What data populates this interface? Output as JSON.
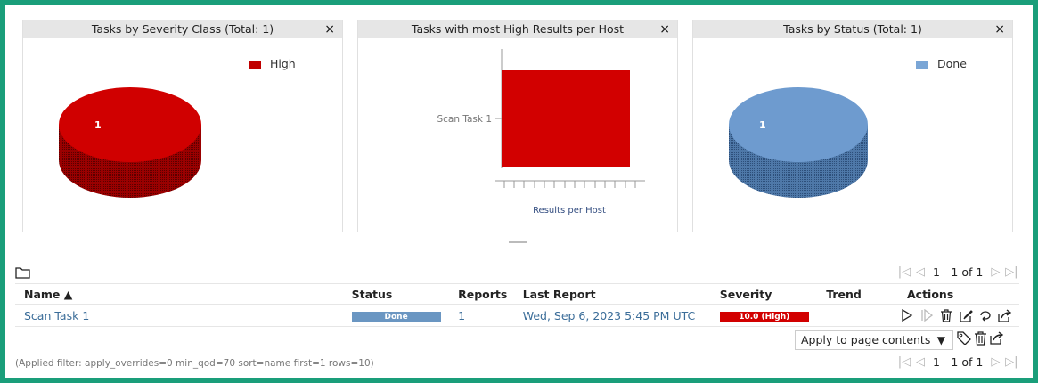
{
  "dashboard": {
    "severity_panel": {
      "title": "Tasks by Severity Class (Total: 1)",
      "legend": "High",
      "slice_label": "1",
      "color": "#d20000"
    },
    "hosts_panel": {
      "title": "Tasks with most High Results per Host",
      "category_label": "Scan Task 1",
      "xlabel": "Results per Host",
      "color": "#d20000"
    },
    "status_panel": {
      "title": "Tasks by Status (Total: 1)",
      "legend": "Done",
      "slice_label": "1",
      "color": "#6a96c2"
    },
    "close_symbol": "×"
  },
  "pager_top": {
    "text": "1 - 1 of 1"
  },
  "pager_bottom": {
    "text": "1 - 1 of 1"
  },
  "table": {
    "headers": {
      "name": "Name ▲",
      "status": "Status",
      "reports": "Reports",
      "last_report": "Last Report",
      "severity": "Severity",
      "trend": "Trend",
      "actions": "Actions"
    },
    "rows": [
      {
        "name": "Scan Task 1",
        "status": "Done",
        "reports": "1",
        "last_report": "Wed, Sep 6, 2023 5:45 PM UTC",
        "severity": "10.0 (High)"
      }
    ]
  },
  "bulk": {
    "apply_label": "Apply to page contents"
  },
  "filter": {
    "text": "(Applied filter: apply_overrides=0 min_qod=70 sort=name first=1 rows=10)"
  },
  "icons": [
    "folder-icon",
    "first-page-icon",
    "prev-page-icon",
    "next-page-icon",
    "last-page-icon",
    "start-icon",
    "resume-icon",
    "trash-icon",
    "edit-icon",
    "clone-icon",
    "export-icon",
    "tag-icon"
  ]
}
